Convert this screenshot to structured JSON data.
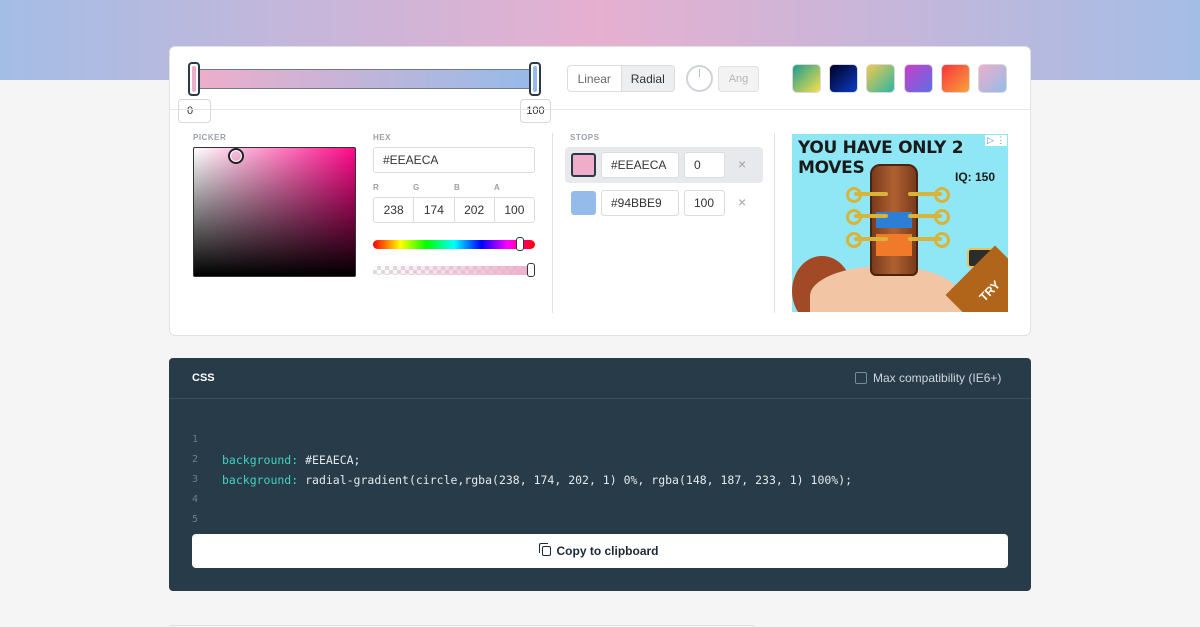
{
  "gradient": {
    "start_color": "#EEAECA",
    "end_color": "#94BBE9",
    "start_position": "0",
    "end_position": "100"
  },
  "type_toggle": {
    "linear_label": "Linear",
    "radial_label": "Radial",
    "selected": "Radial"
  },
  "angle": {
    "placeholder": "Ang"
  },
  "presets": [
    {
      "name": "preset-1",
      "colors": [
        "#1e9c8f",
        "#f7e04a"
      ]
    },
    {
      "name": "preset-2",
      "colors": [
        "#020024",
        "#0a3cc4"
      ]
    },
    {
      "name": "preset-3",
      "colors": [
        "#f2c94c",
        "#2bb5a6"
      ]
    },
    {
      "name": "preset-4",
      "colors": [
        "#c83fc8",
        "#5d6ee8"
      ]
    },
    {
      "name": "preset-5",
      "colors": [
        "#f8343c",
        "#f9a23a"
      ]
    },
    {
      "name": "preset-6",
      "colors": [
        "#eeaeca",
        "#94bbe9"
      ]
    }
  ],
  "picker": {
    "label": "PICKER",
    "hex_label": "HEX",
    "hex_value": "#EEAECA",
    "rgba_labels": {
      "r": "R",
      "g": "G",
      "b": "B",
      "a": "A"
    },
    "r": "238",
    "g": "174",
    "b": "202",
    "a": "100"
  },
  "stops": {
    "label": "STOPS",
    "items": [
      {
        "color": "#EEAECA",
        "hex": "#EEAECA",
        "position": "0",
        "remove": "×"
      },
      {
        "color": "#94BBE9",
        "hex": "#94BBE9",
        "position": "100",
        "remove": "×"
      }
    ]
  },
  "ad": {
    "headline": "YOU HAVE ONLY 2 MOVES",
    "iq": "IQ: 150",
    "cta": "TRY",
    "info": "▷ ⋮"
  },
  "css_panel": {
    "title": "CSS",
    "compat_label": "Max compatibility (IE6+)",
    "lines": [
      {
        "num": "1",
        "prop": "background:",
        "value": " #EEAECA;"
      },
      {
        "num": "2",
        "prop": "background:",
        "value": " radial-gradient(circle,rgba(238, 174, 202, 1) 0%, rgba(148, 187, 233, 1) 100%);"
      },
      {
        "num": "3",
        "prop": "",
        "value": ""
      },
      {
        "num": "4",
        "prop": "",
        "value": ""
      },
      {
        "num": "5",
        "prop": "",
        "value": ""
      }
    ],
    "copy_label": "Copy to clipboard"
  }
}
